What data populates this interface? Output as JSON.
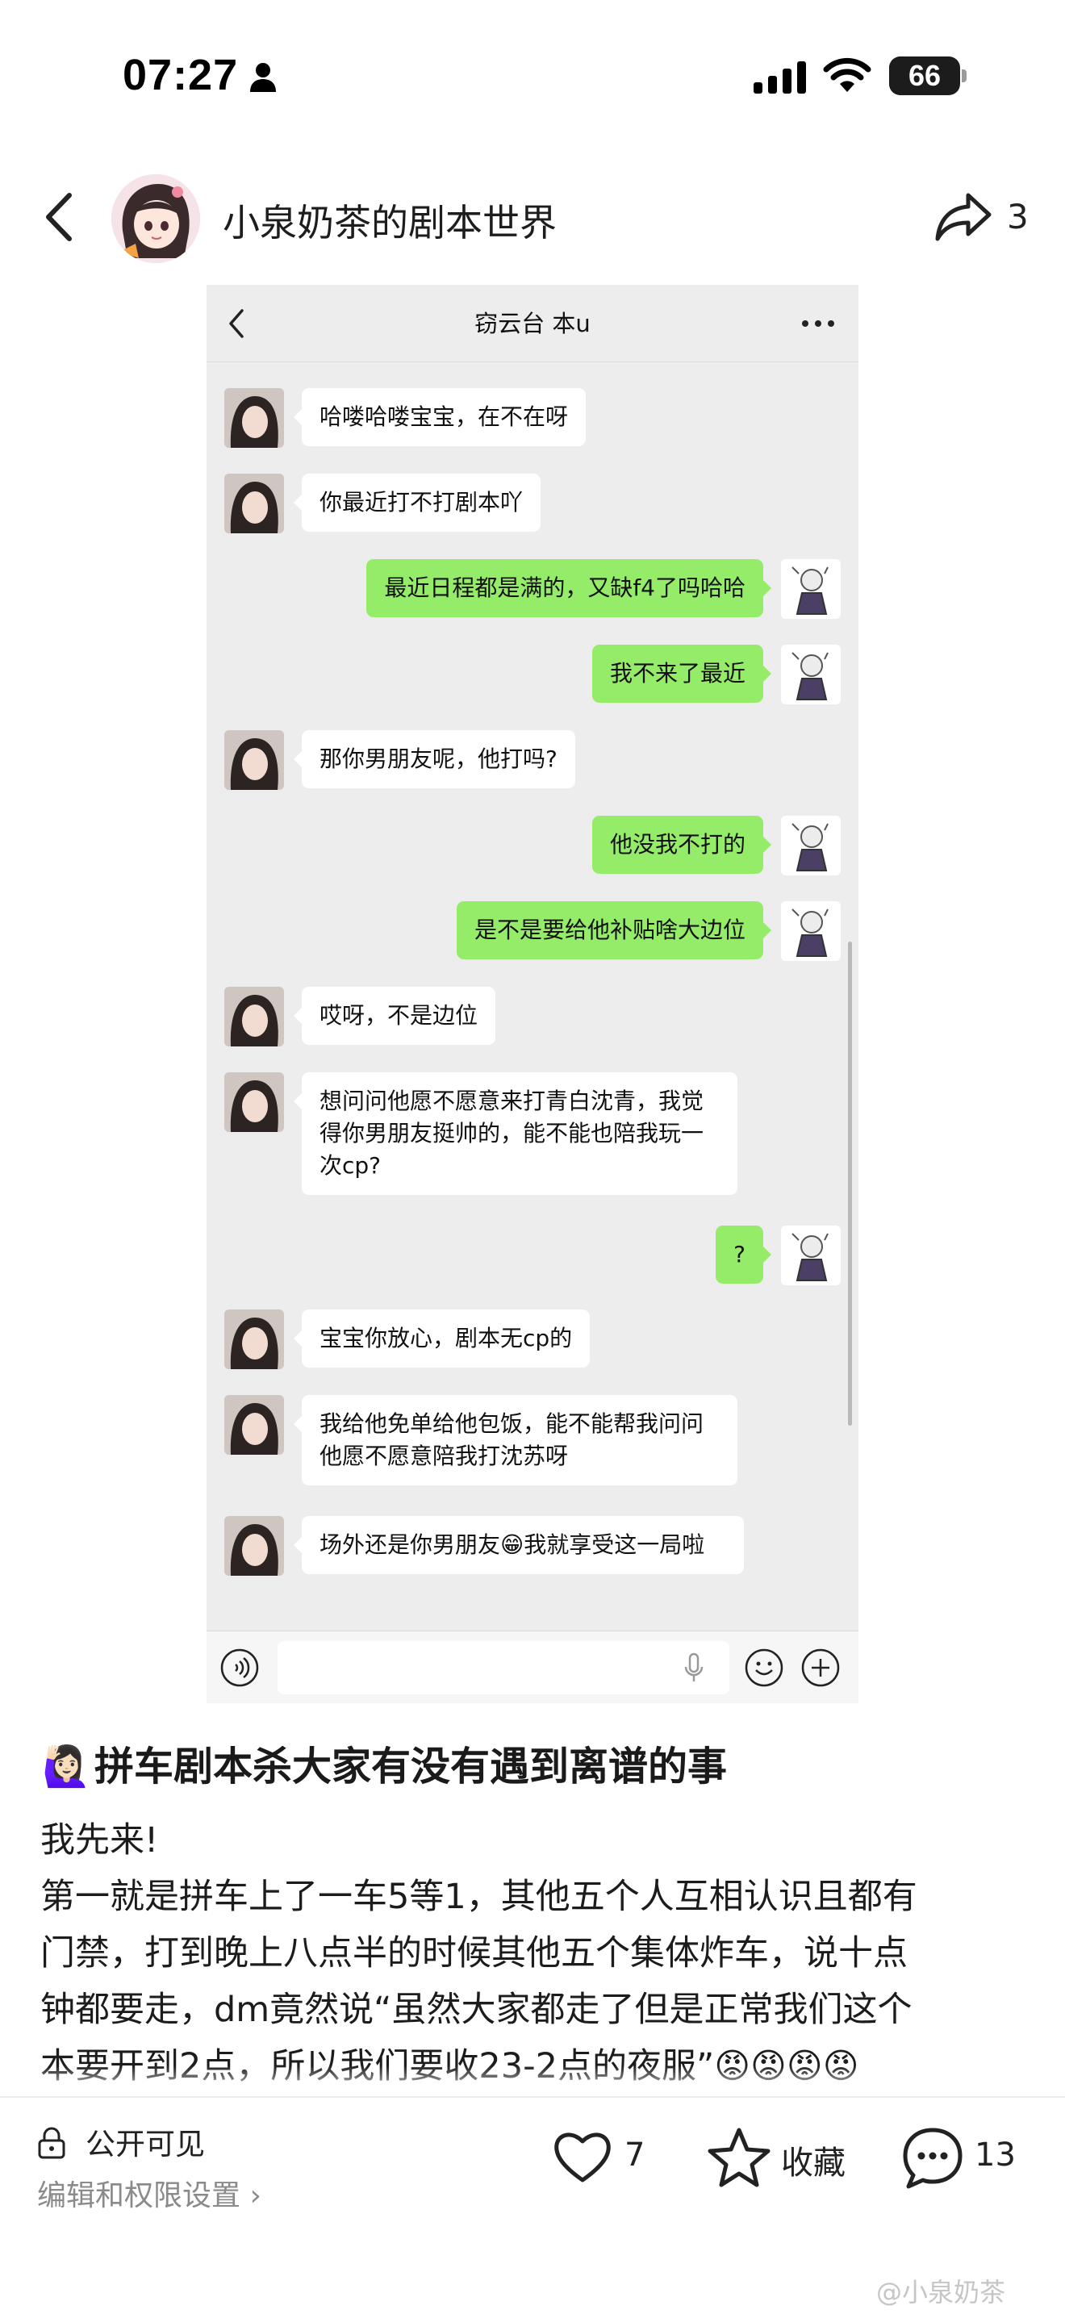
{
  "status_bar": {
    "time": "07:27",
    "battery": "66",
    "battery_level_percent": 66,
    "icons": [
      "person-icon",
      "cellular-signal-icon",
      "wifi-icon",
      "battery-icon"
    ]
  },
  "header": {
    "author_name": "小泉奶茶的剧本世界",
    "share_count": "3"
  },
  "chat": {
    "title": "窃云台 本u",
    "messages": [
      {
        "side": "in",
        "text": "哈喽哈喽宝宝，在不在呀"
      },
      {
        "side": "in",
        "text": "你最近打不打剧本吖"
      },
      {
        "side": "out",
        "text": "最近日程都是满的，又缺f4了吗哈哈"
      },
      {
        "side": "out",
        "text": "我不来了最近"
      },
      {
        "side": "in",
        "text": "那你男朋友呢，他打吗?"
      },
      {
        "side": "out",
        "text": "他没我不打的"
      },
      {
        "side": "out",
        "text": "是不是要给他补贴啥大边位"
      },
      {
        "side": "in",
        "text": "哎呀，不是边位"
      },
      {
        "side": "in",
        "text": "想问问他愿不愿意来打青白沈青，我觉得你男朋友挺帅的，能不能也陪我玩一次cp?"
      },
      {
        "side": "out",
        "text": "?"
      },
      {
        "side": "in",
        "text": "宝宝你放心，剧本无cp的"
      },
      {
        "side": "in",
        "text": "我给他免单给他包饭，能不能帮我问问他愿不愿意陪我打沈苏呀"
      },
      {
        "side": "in",
        "text": "场外还是你男朋友😁我就享受这一局啦"
      }
    ]
  },
  "post": {
    "title_emoji": "🙋🏻‍♀️",
    "title": "拼车剧本杀大家有没有遇到离谱的事",
    "body": [
      "我先来!",
      "第一就是拼车上了一车5等1，其他五个人互相认识且都有",
      "门禁，打到晚上八点半的时候其他五个集体炸车，说十点",
      "钟都要走，dm竟然说“虽然大家都走了但是正常我们这个",
      "本要开到2点，所以我们要收23-2点的夜服”😡😡😡😡"
    ]
  },
  "bottom_bar": {
    "visibility_label": "公开可见",
    "settings_link": "编辑和权限设置 ›",
    "like_count": "7",
    "favorite_label": "收藏",
    "comment_count": "13"
  },
  "watermark": "@小泉奶茶"
}
